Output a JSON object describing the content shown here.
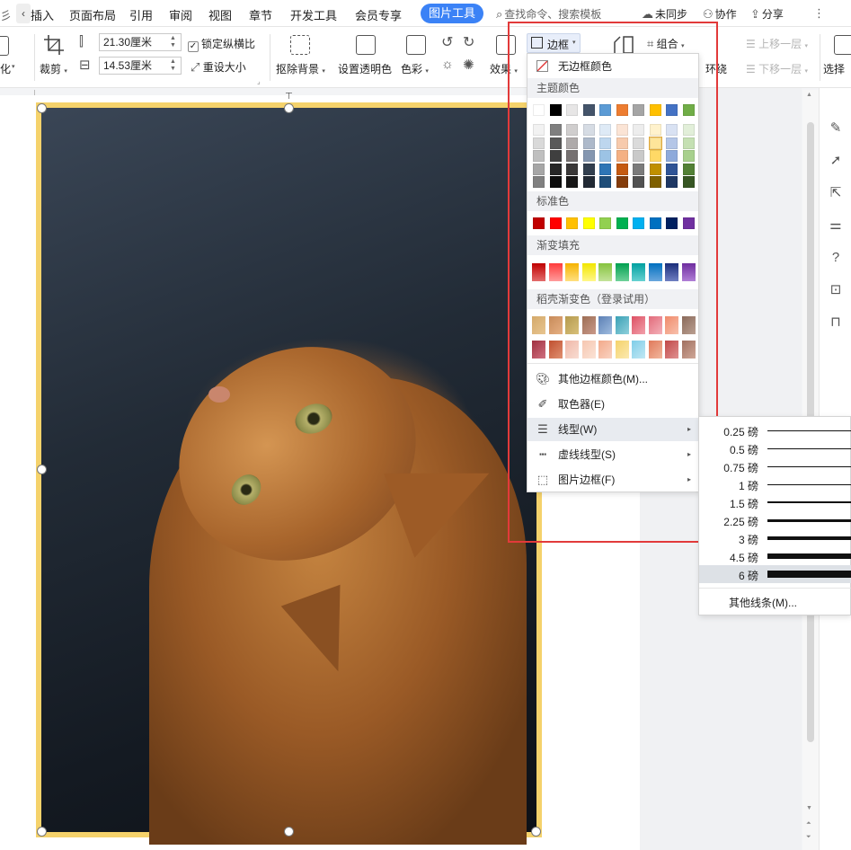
{
  "menubar": {
    "left_edge_text": "彡",
    "items": [
      "插入",
      "页面布局",
      "引用",
      "审阅",
      "视图",
      "章节",
      "开发工具",
      "会员专享"
    ],
    "active_tab": "图片工具",
    "search_placeholder": "查找命令、搜索模板",
    "cloud": "未同步",
    "collab": "协作",
    "share": "分享",
    "more": "⋮"
  },
  "ribbon": {
    "crop": "裁剪",
    "crop_prefix": "化",
    "width_value": "21.30厘米",
    "height_value": "14.53厘米",
    "lock_ratio": "锁定纵横比",
    "reset_size": "重设大小",
    "remove_bg": "抠除背景",
    "set_transparent": "设置透明色",
    "color": "色彩",
    "effect": "效果",
    "border": "边框",
    "group": "组合",
    "wrap": "环绕",
    "bring_forward": "上移一层",
    "send_backward": "下移一层",
    "select": "选择"
  },
  "dropdown": {
    "no_border": "无边框颜色",
    "theme_colors": "主题颜色",
    "standard_colors": "标准色",
    "gradient_fill": "渐变填充",
    "shell_gradient": "稻壳渐变色（登录试用）",
    "more_colors": "其他边框颜色(M)...",
    "picker": "取色器(E)",
    "line_type": "线型(W)",
    "dash_type": "虚线线型(S)",
    "picture_border": "图片边框(F)",
    "theme_top": [
      "#ffffff",
      "#000000",
      "#e7e6e6",
      "#44546a",
      "#5b9bd5",
      "#ed7d31",
      "#a5a5a5",
      "#ffc000",
      "#4472c4",
      "#70ad47"
    ],
    "theme_tints": [
      [
        "#f2f2f2",
        "#7f7f7f",
        "#d0cece",
        "#d6dce4",
        "#deeaf6",
        "#fbe4d5",
        "#ededed",
        "#fff2cc",
        "#d9e2f3",
        "#e2efd9"
      ],
      [
        "#d9d9d9",
        "#595959",
        "#aeaaaa",
        "#adb9ca",
        "#bdd6ee",
        "#f7caac",
        "#dbdbdb",
        "#fee599",
        "#b4c6e7",
        "#c5e0b3"
      ],
      [
        "#bfbfbf",
        "#3f3f3f",
        "#757070",
        "#8496b0",
        "#9cc3e5",
        "#f4b083",
        "#c9c9c9",
        "#ffd966",
        "#8eaadb",
        "#a8d08d"
      ],
      [
        "#a6a6a6",
        "#262626",
        "#3a3838",
        "#323f4f",
        "#2e75b5",
        "#c55a11",
        "#7b7b7b",
        "#bf8f00",
        "#2f5496",
        "#538135"
      ],
      [
        "#808080",
        "#0d0d0d",
        "#171616",
        "#222a35",
        "#1f4e79",
        "#843c0b",
        "#525252",
        "#7f6000",
        "#1f3864",
        "#375623"
      ]
    ],
    "standard": [
      "#c00000",
      "#ff0000",
      "#ffc000",
      "#ffff00",
      "#92d050",
      "#00b050",
      "#00b0f0",
      "#0070c0",
      "#002060",
      "#7030a0"
    ],
    "gradients": [
      [
        "#c00000",
        "#e36c6c"
      ],
      [
        "#ff3b3b",
        "#ff9c9c"
      ],
      [
        "#f5b300",
        "#ffe080"
      ],
      [
        "#f2e600",
        "#fff78a"
      ],
      [
        "#86c33e",
        "#c4e39a"
      ],
      [
        "#00a050",
        "#6fd19a"
      ],
      [
        "#00a0a0",
        "#66d1d1"
      ],
      [
        "#0070c0",
        "#6aa7dd"
      ],
      [
        "#1a2d7a",
        "#6f7fc2"
      ],
      [
        "#6f2d9f",
        "#b07fd6"
      ]
    ],
    "shell_row1": [
      [
        "#d4a96a",
        "#e8c590"
      ],
      [
        "#c88b5a",
        "#e6b083"
      ],
      [
        "#b59a4e",
        "#d8c07a"
      ],
      [
        "#9d6e54",
        "#c9998a"
      ],
      [
        "#5c80b5",
        "#9fbcdf"
      ],
      [
        "#3aa1b5",
        "#8fd0dc"
      ],
      [
        "#dd5063",
        "#f2a0ab"
      ],
      [
        "#e26b7b",
        "#f4b1b9"
      ],
      [
        "#f08a6a",
        "#f8c1ad"
      ],
      [
        "#8a6a5a",
        "#bba092"
      ]
    ],
    "shell_row2": [
      [
        "#a03040",
        "#d07080"
      ],
      [
        "#c05030",
        "#e09070"
      ],
      [
        "#f0b8a8",
        "#f8dcd2"
      ],
      [
        "#f6c6b0",
        "#fbe3d6"
      ],
      [
        "#f3a98a",
        "#f9d3c2"
      ],
      [
        "#f5d26b",
        "#fbe9b0"
      ],
      [
        "#7fcde8",
        "#c2e8f4"
      ],
      [
        "#e07a5a",
        "#f2b79e"
      ],
      [
        "#c04848",
        "#e09090"
      ],
      [
        "#a07060",
        "#d0a898"
      ]
    ]
  },
  "linetype_menu": {
    "rows": [
      "0.25 磅",
      "0.5 磅",
      "0.75 磅",
      "1 磅",
      "1.5 磅",
      "2.25 磅",
      "3 磅",
      "4.5 磅",
      "6 磅"
    ],
    "weights": [
      0.25,
      0.5,
      0.75,
      1,
      1.5,
      2.25,
      3,
      4.5,
      6
    ],
    "selected": "6 磅",
    "more": "其他线条(M)..."
  },
  "image": {
    "border_color": "#f5d26b"
  }
}
